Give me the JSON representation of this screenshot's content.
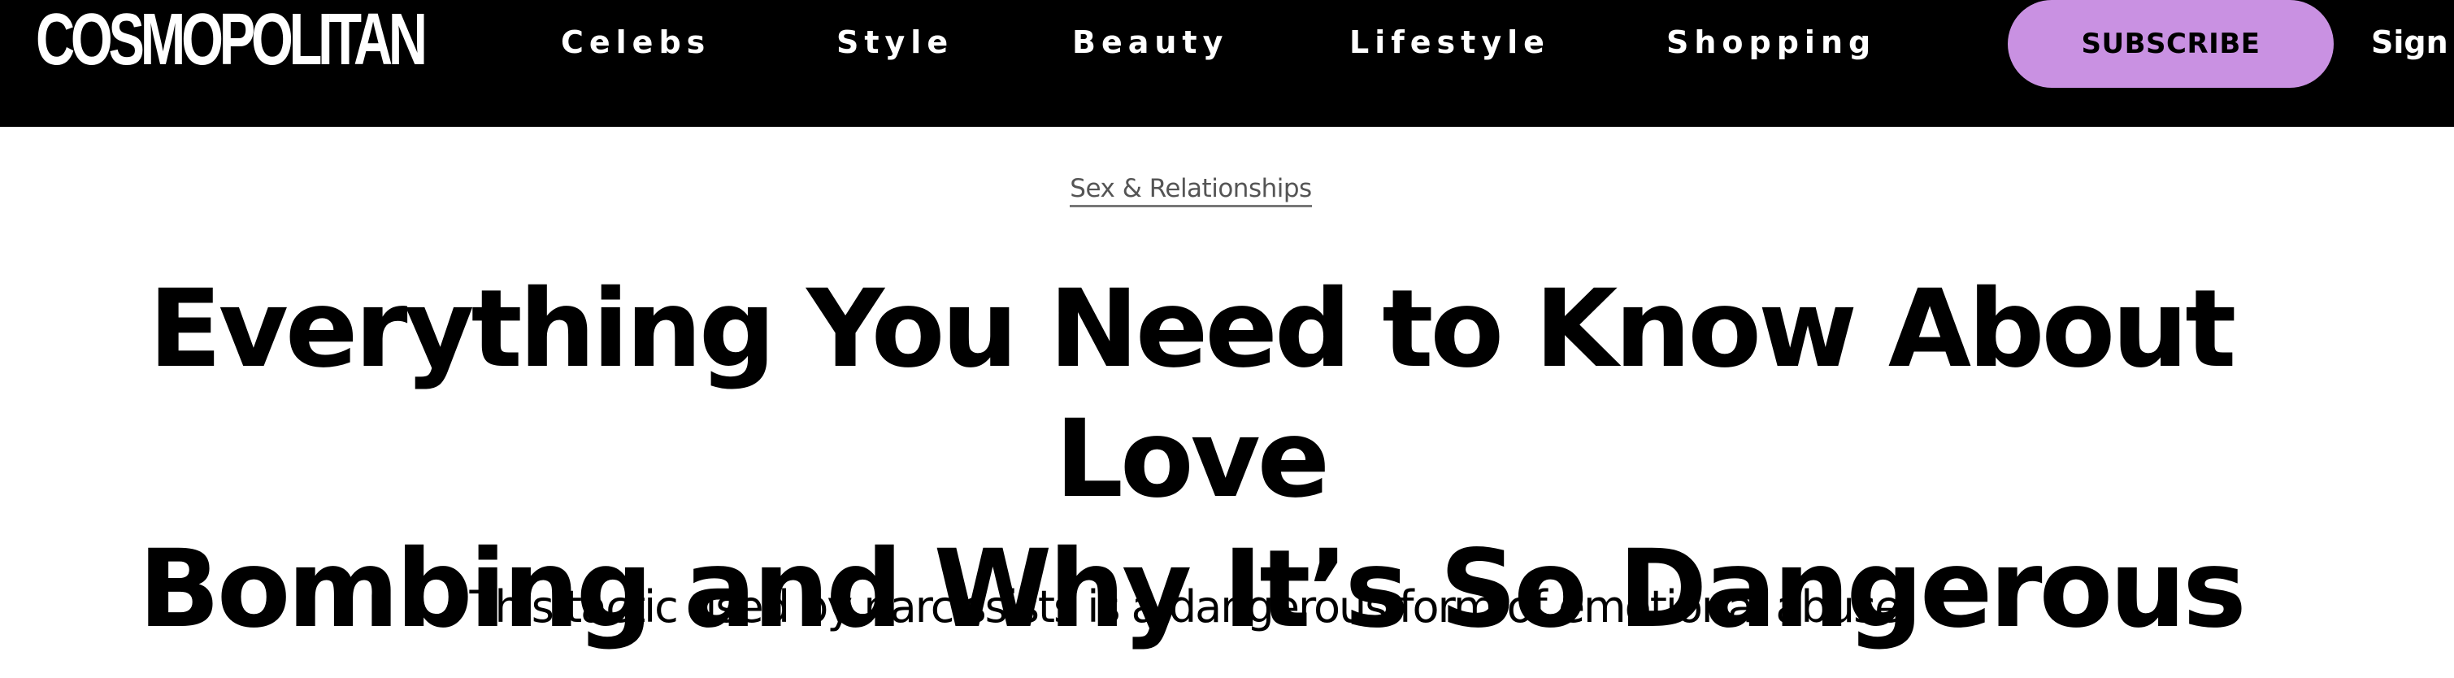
{
  "header": {
    "logo": "COSMOPOLITAN",
    "nav": [
      {
        "label": "Celebs"
      },
      {
        "label": "Style"
      },
      {
        "label": "Beauty"
      },
      {
        "label": "Lifestyle"
      },
      {
        "label": "Shopping"
      }
    ],
    "subscribe_label": "SUBSCRIBE",
    "sign_in_label": "Sign I"
  },
  "article": {
    "category": "Sex & Relationships",
    "headline_line1": "Everything You Need to Know About Love",
    "headline_line2": "Bombing and Why It’s So Dangerous",
    "dek": "This tactic used by narcissists is a dangerous form of emotional abuse."
  },
  "colors": {
    "nav_background": "#000000",
    "subscribe_button": "#c991e2",
    "text": "#000000",
    "category_text": "#555555"
  }
}
